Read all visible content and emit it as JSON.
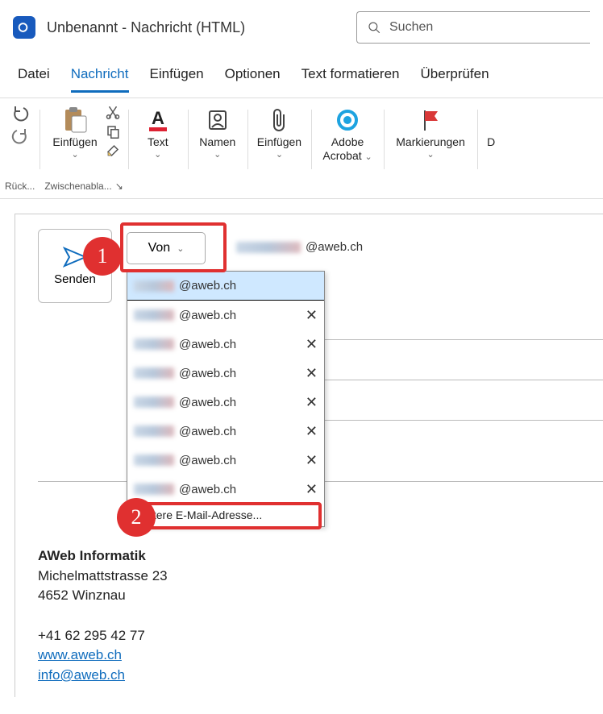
{
  "window": {
    "title": "Unbenannt  -  Nachricht (HTML)"
  },
  "search": {
    "placeholder": "Suchen"
  },
  "tabs": [
    "Datei",
    "Nachricht",
    "Einfügen",
    "Optionen",
    "Text formatieren",
    "Überprüfen"
  ],
  "active_tab_index": 1,
  "ribbon": {
    "undo": {
      "label": "Rück..."
    },
    "clipboard": {
      "paste_label": "Einfügen",
      "group_label": "Zwischenabla..."
    },
    "text": {
      "label": "Text"
    },
    "names": {
      "label": "Namen"
    },
    "include": {
      "label": "Einfügen"
    },
    "adobe": {
      "label_top": "Adobe",
      "label_bottom": "Acrobat"
    },
    "tags": {
      "label": "Markierungen"
    },
    "cutoff": {
      "label": "D"
    }
  },
  "compose": {
    "send": "Senden",
    "from_button": "Von",
    "from_value_suffix": "@aweb.ch",
    "dropdown": {
      "items_suffixes": [
        "@aweb.ch",
        "@aweb.ch",
        "@aweb.ch",
        "@aweb.ch",
        "@aweb.ch",
        "@aweb.ch",
        "@aweb.ch",
        "@aweb.ch"
      ],
      "selected_index": 0,
      "more_label": "Weitere E-Mail-Adresse..."
    }
  },
  "markers": {
    "one": "1",
    "two": "2"
  },
  "signature": {
    "name": "AWeb Informatik",
    "street": "Michelmattstrasse 23",
    "city": "4652 Winznau",
    "phone": "+41 62 295 42 77",
    "web": "www.aweb.ch",
    "email": "info@aweb.ch"
  }
}
